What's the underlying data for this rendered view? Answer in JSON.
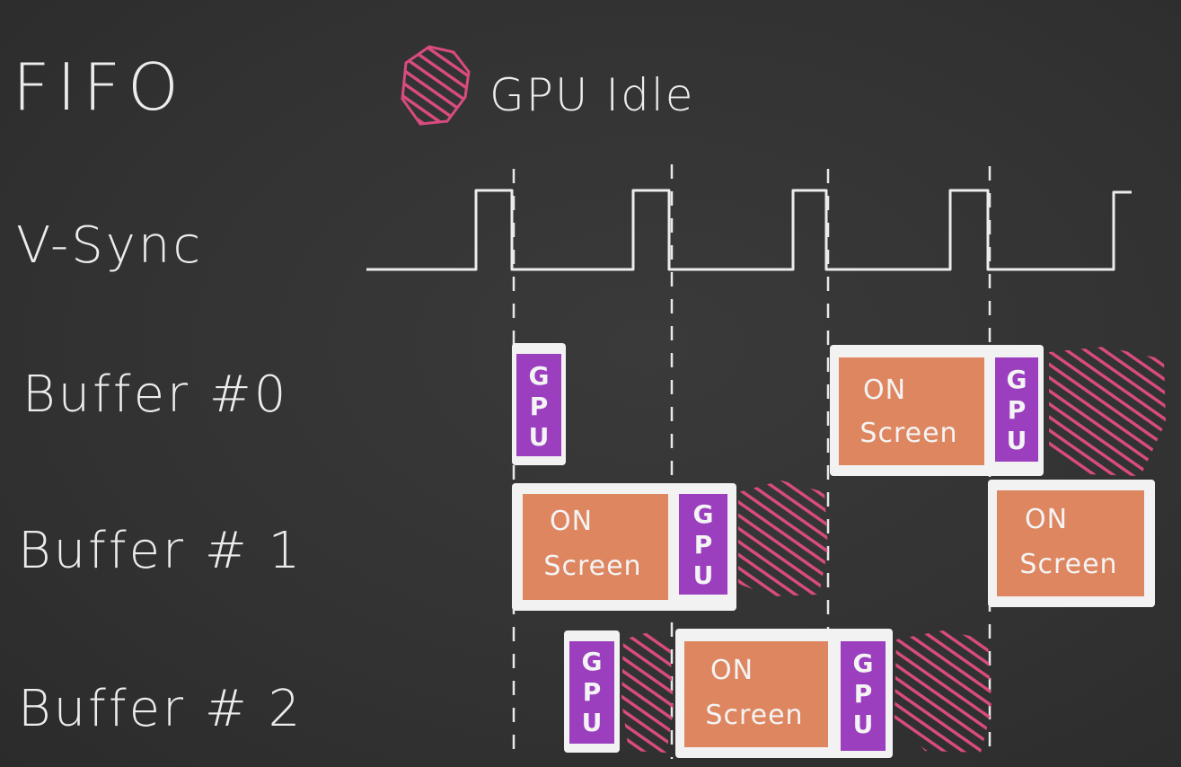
{
  "title": "FIFO",
  "legend": {
    "label": "GPU Idle",
    "color": "#d94b7f"
  },
  "rows": {
    "vsync": "V-Sync",
    "buffer0": "Buffer #0",
    "buffer1": "Buffer # 1",
    "buffer2": "Buffer # 2"
  },
  "blocks": {
    "on_line1": "ON",
    "on_line2": "Screen",
    "gpu_letters": [
      "G",
      "P",
      "U"
    ]
  },
  "colors": {
    "background": "#333333",
    "chalk": "#ececec",
    "on_screen": "#de8660",
    "gpu": "#9b3fbf",
    "idle": "#d94b7f",
    "box_border": "#f2f2f2"
  }
}
